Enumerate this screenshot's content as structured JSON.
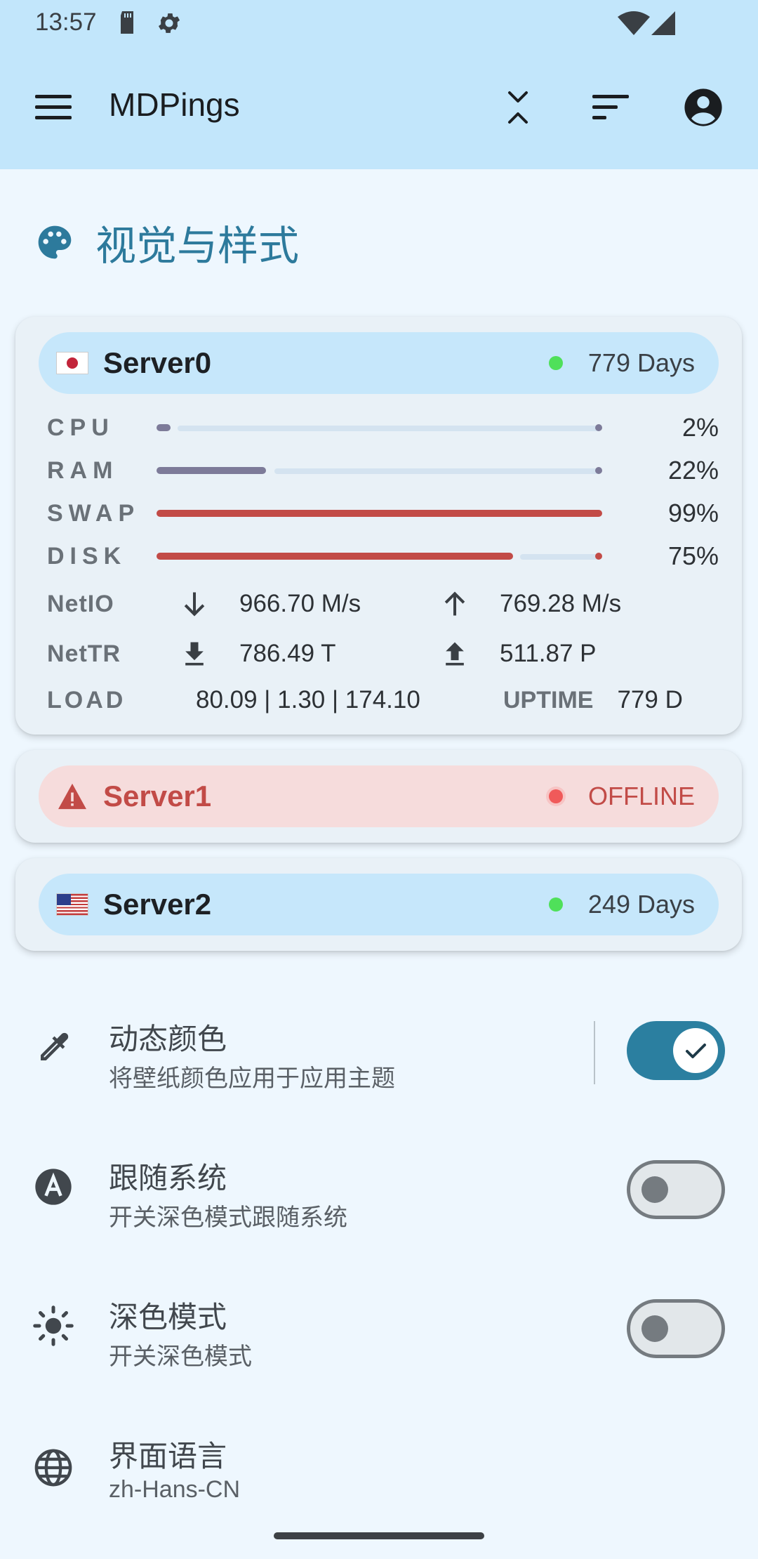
{
  "status_bar": {
    "time": "13:57"
  },
  "toolbar": {
    "title": "MDPings"
  },
  "section": {
    "title": "视觉与样式"
  },
  "servers": [
    {
      "name": "Server0",
      "status": "779 Days",
      "online": true,
      "flag": "japan",
      "metrics": [
        {
          "label": "CPU",
          "percent": 2,
          "percent_text": "2%"
        },
        {
          "label": "RAM",
          "percent": 22,
          "percent_text": "22%"
        },
        {
          "label": "SWAP",
          "percent": 99,
          "percent_text": "99%"
        },
        {
          "label": "DISK",
          "percent": 75,
          "percent_text": "75%"
        }
      ],
      "netio": {
        "label": "NetIO",
        "down": "966.70 M/s",
        "up": "769.28 M/s"
      },
      "nettr": {
        "label": "NetTR",
        "down": "786.49 T",
        "up": "511.87 P"
      },
      "load": {
        "label": "LOAD",
        "value": "80.09 | 1.30 | 174.10"
      },
      "uptime": {
        "label": "UPTIME",
        "value": "779 D"
      }
    },
    {
      "name": "Server1",
      "status": "OFFLINE",
      "online": false,
      "icon": "warning-icon"
    },
    {
      "name": "Server2",
      "status": "249 Days",
      "online": true,
      "flag": "usa"
    }
  ],
  "settings": [
    {
      "title": "动态颜色",
      "subtitle": "将壁纸颜色应用于应用主题",
      "icon": "eyedropper-icon",
      "toggle": true
    },
    {
      "title": "跟随系统",
      "subtitle": "开关深色模式跟随系统",
      "icon": "auto-brightness-icon",
      "toggle": false
    },
    {
      "title": "深色模式",
      "subtitle": "开关深色模式",
      "icon": "sun-icon",
      "toggle": false
    },
    {
      "title": "界面语言",
      "subtitle": "zh-Hans-CN",
      "icon": "globe-icon"
    }
  ],
  "colors": {
    "appbar": "#c2e6fb",
    "accent": "#2b7fa0",
    "danger": "#c24b47",
    "online_dot": "#4fe05a",
    "offline_dot": "#f05a5a"
  }
}
